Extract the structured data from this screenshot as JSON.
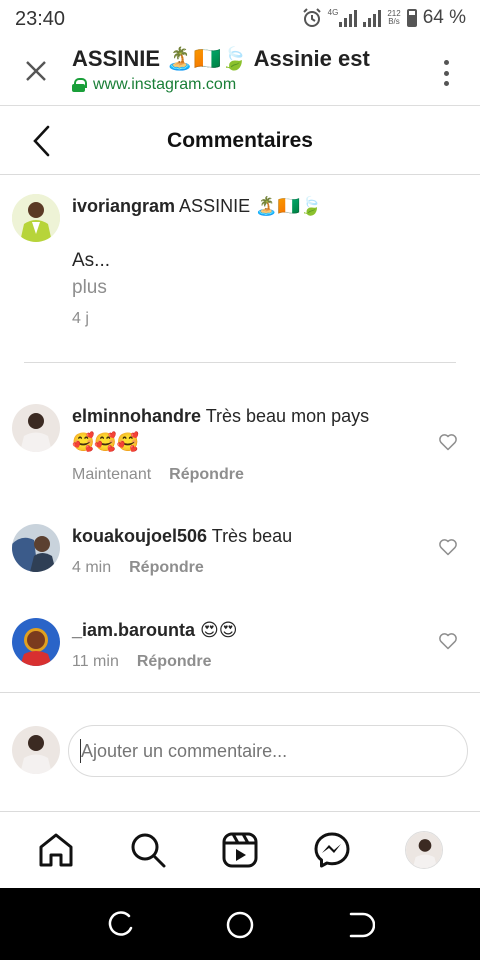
{
  "status_bar": {
    "time": "23:40",
    "network": "4G",
    "speed_value": "212",
    "speed_unit": "B/s",
    "battery": "64 %"
  },
  "browser": {
    "title": "ASSINIE 🏝️🇨🇮🍃 Assinie est",
    "url": "www.instagram.com",
    "close_icon": "close-icon",
    "menu_icon": "more-vert-icon"
  },
  "page": {
    "title": "Commentaires",
    "back_icon": "chevron-left-icon"
  },
  "caption": {
    "username": "ivoriangram",
    "text": " ASSINIE 🏝️🇨🇮🍃",
    "body": "As...",
    "more": "plus",
    "time": "4 j"
  },
  "comments": [
    {
      "username": "elminnohandre",
      "text": " Très beau mon pays",
      "text2": "🥰🥰🥰",
      "time": "Maintenant",
      "reply": "Répondre"
    },
    {
      "username": "kouakoujoel506",
      "text": " Très beau",
      "time": "4 min",
      "reply": "Répondre"
    },
    {
      "username": "_iam.barounta",
      "text": " 😍😍",
      "time": "11 min",
      "reply": "Répondre"
    }
  ],
  "composer": {
    "placeholder": "Ajouter un commentaire..."
  },
  "colors": {
    "text": "#262626",
    "muted": "#8e8e8e",
    "divider": "#dbdbdb",
    "url_green": "#1a7f37"
  }
}
